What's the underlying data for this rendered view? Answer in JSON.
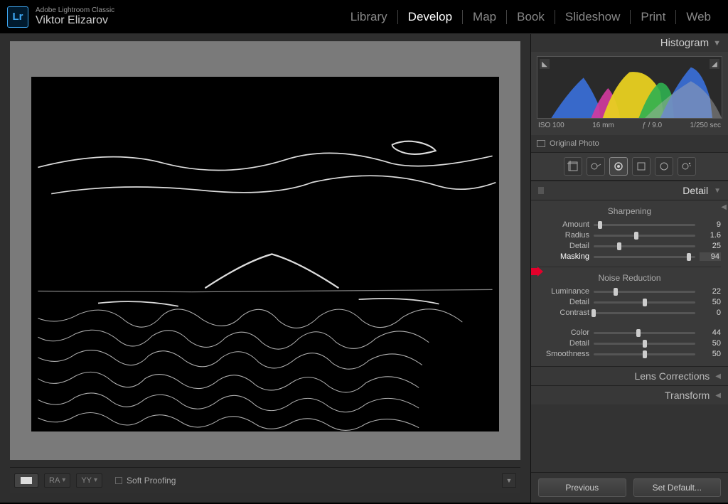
{
  "app": {
    "title": "Adobe Lightroom Classic",
    "user": "Viktor Elizarov"
  },
  "nav": {
    "items": [
      "Library",
      "Develop",
      "Map",
      "Book",
      "Slideshow",
      "Print",
      "Web"
    ],
    "active": "Develop"
  },
  "histogram": {
    "title": "Histogram",
    "exif": {
      "iso": "ISO 100",
      "focal": "16 mm",
      "aperture": "ƒ / 9.0",
      "shutter": "1/250 sec"
    },
    "original_label": "Original Photo"
  },
  "tools": [
    "crop",
    "spot",
    "eye",
    "grad",
    "radial",
    "brush"
  ],
  "detail_panel": {
    "title": "Detail",
    "sharpening": {
      "title": "Sharpening",
      "amount_label": "Amount",
      "amount_value": "9",
      "radius_label": "Radius",
      "radius_value": "1.6",
      "detail_label": "Detail",
      "detail_value": "25",
      "masking_label": "Masking",
      "masking_value": "94"
    },
    "noise": {
      "title": "Noise Reduction",
      "luminance_label": "Luminance",
      "luminance_value": "22",
      "detail_label": "Detail",
      "detail_value": "50",
      "contrast_label": "Contrast",
      "contrast_value": "0",
      "color_label": "Color",
      "color_value": "44",
      "cdetail_label": "Detail",
      "cdetail_value": "50",
      "smooth_label": "Smoothness",
      "smooth_value": "50"
    }
  },
  "collapsed": {
    "lens": "Lens Corrections",
    "transform": "Transform"
  },
  "buttons": {
    "previous": "Previous",
    "defaults": "Set Default..."
  },
  "bottombar": {
    "soft_proof": "Soft Proofing",
    "ra": "RA",
    "yy": "YY"
  }
}
